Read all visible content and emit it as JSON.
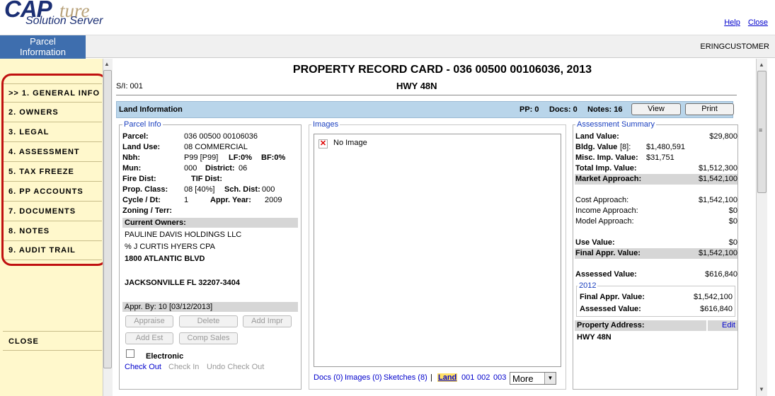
{
  "header": {
    "logo_cap": "CAP",
    "logo_ture": "ture",
    "logo_sub": "Solution Server",
    "help_link": "Help",
    "close_link": "Close"
  },
  "subheader": {
    "tab_label_line1": "Parcel",
    "tab_label_line2": "Information",
    "username": "ERINGCUSTOMER"
  },
  "nav": {
    "items": [
      {
        "label": ">> 1. GENERAL INFO"
      },
      {
        "label": "2. OWNERS"
      },
      {
        "label": "3. LEGAL"
      },
      {
        "label": "4. ASSESSMENT"
      },
      {
        "label": "5. TAX FREEZE"
      },
      {
        "label": "6. PP ACCOUNTS"
      },
      {
        "label": "7. DOCUMENTS"
      },
      {
        "label": "8. NOTES"
      },
      {
        "label": "9. AUDIT TRAIL"
      }
    ],
    "close_label": "CLOSE"
  },
  "record": {
    "title": "PROPERTY RECORD CARD - 036 00500 00106036, 2013",
    "sl": "S/I: 001",
    "address_head": "HWY 48N"
  },
  "land_bar": {
    "label": "Land Information",
    "pp": "PP: 0",
    "docs": "Docs: 0",
    "notes": "Notes: 16",
    "view_button": "View",
    "print_button": "Print"
  },
  "parcel_info": {
    "legend": "Parcel Info",
    "parcel_label": "Parcel:",
    "parcel_value": "036 00500 00106036",
    "land_use_label": "Land Use:",
    "land_use_value": "08 COMMERCIAL",
    "nbh_label": "Nbh:",
    "nbh_value": "P99  [P99]",
    "lf_label": "LF:0%",
    "bf_label": "BF:0%",
    "mun_label": "Mun:",
    "mun_value": "000",
    "district_label": "District:",
    "district_value": "06",
    "fire_label": "Fire Dist:",
    "tif_label": "TIF Dist:",
    "prop_class_label": "Prop. Class:",
    "prop_class_value": "08  [40%]",
    "sch_dist_label": "Sch. Dist:",
    "sch_dist_value": "000",
    "cycle_label": "Cycle / Dt:",
    "cycle_value": "1",
    "appr_year_label": "Appr. Year:",
    "appr_year_value": "2009",
    "zoning_label": "Zoning / Terr:",
    "owners_header": "Current Owners:",
    "owner_line1": "PAULINE DAVIS HOLDINGS LLC",
    "owner_line2": "% J CURTIS HYERS CPA",
    "owner_line3": "1800 ATLANTIC BLVD",
    "owner_line4": "JACKSONVILLE FL 32207-3404",
    "appr_by": "Appr. By: 10 [03/12/2013]",
    "btn_appraise": "Appraise",
    "btn_delete": "Delete",
    "btn_add_impr": "Add Impr",
    "btn_add_est": "Add Est",
    "btn_comp_sales": "Comp Sales",
    "electronic_label": "Electronic",
    "check_out": "Check Out",
    "check_in": "Check In",
    "undo_check_out": "Undo Check Out"
  },
  "images": {
    "legend": "Images",
    "no_image": "No Image",
    "docs_link": "Docs (0)",
    "images_link": "Images (0)",
    "sketches_link": "Sketches (8)",
    "separator": "|",
    "land_link": "Land",
    "link_001": "001",
    "link_002": "002",
    "link_003": "003",
    "more_select": "More"
  },
  "assessment": {
    "legend": "Assessment Summary",
    "land_value_label": "Land Value:",
    "land_value": "$29,800",
    "bldg_value_label": "Bldg. Value",
    "bldg_count": "[8]:",
    "bldg_value": "$1,480,591",
    "misc_label": "Misc. Imp. Value:",
    "misc_value": "$31,751",
    "total_imp_label": "Total Imp. Value:",
    "total_imp_value": "$1,512,300",
    "market_label": "Market Approach:",
    "market_value": "$1,542,100",
    "cost_label": "Cost Approach:",
    "cost_value": "$1,542,100",
    "income_label": "Income Approach:",
    "income_value": "$0",
    "model_label": "Model Approach:",
    "model_value": "$0",
    "use_label": "Use Value:",
    "use_value": "$0",
    "final_label": "Final Appr. Value:",
    "final_value": "$1,542,100",
    "assessed_label": "Assessed Value:",
    "assessed_value": "$616,840",
    "prior_year": "2012",
    "prior_final_label": "Final Appr. Value:",
    "prior_final_value": "$1,542,100",
    "prior_assessed_label": "Assessed Value:",
    "prior_assessed_value": "$616,840",
    "prop_addr_label": "Property Address:",
    "edit_link": "Edit",
    "prop_addr_value": "HWY 48N"
  }
}
